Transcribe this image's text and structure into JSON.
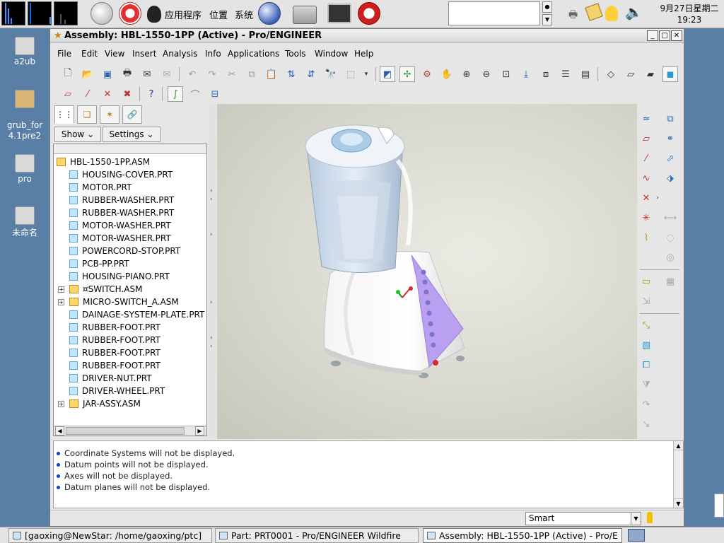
{
  "top_panel": {
    "menus": [
      "应用程序",
      "位置",
      "系统"
    ],
    "clock_date": "9月27日星期二",
    "clock_time": "19:23"
  },
  "desktop_icons": [
    "a2ub",
    "grub_for\n4.1pre2",
    "pro",
    "未命名"
  ],
  "window": {
    "title": "Assembly: HBL-1550-1PP (Active) - Pro/ENGINEER"
  },
  "menu": [
    "File",
    "Edit",
    "View",
    "Insert",
    "Analysis",
    "Info",
    "Applications",
    "Tools",
    "Window",
    "Help"
  ],
  "left_panel": {
    "show_label": "Show",
    "settings_label": "Settings",
    "tree": [
      {
        "label": "HBL-1550-1PP.ASM",
        "type": "asm",
        "level": 0,
        "expandable": false
      },
      {
        "label": "HOUSING-COVER.PRT",
        "type": "part",
        "level": 1,
        "expandable": false
      },
      {
        "label": "MOTOR.PRT",
        "type": "part",
        "level": 1,
        "expandable": false
      },
      {
        "label": "RUBBER-WASHER.PRT",
        "type": "part",
        "level": 1,
        "expandable": false
      },
      {
        "label": "RUBBER-WASHER.PRT",
        "type": "part",
        "level": 1,
        "expandable": false
      },
      {
        "label": "MOTOR-WASHER.PRT",
        "type": "part",
        "level": 1,
        "expandable": false
      },
      {
        "label": "MOTOR-WASHER.PRT",
        "type": "part",
        "level": 1,
        "expandable": false
      },
      {
        "label": "POWERCORD-STOP.PRT",
        "type": "part",
        "level": 1,
        "expandable": false
      },
      {
        "label": "PCB-PP.PRT",
        "type": "part",
        "level": 1,
        "expandable": false
      },
      {
        "label": "HOUSING-PIANO.PRT",
        "type": "part",
        "level": 1,
        "expandable": false
      },
      {
        "label": "¤SWITCH.ASM",
        "type": "asm",
        "level": 1,
        "expandable": true
      },
      {
        "label": "MICRO-SWITCH_A.ASM",
        "type": "asm",
        "level": 1,
        "expandable": true
      },
      {
        "label": "DAINAGE-SYSTEM-PLATE.PRT",
        "type": "part",
        "level": 1,
        "expandable": false
      },
      {
        "label": "RUBBER-FOOT.PRT",
        "type": "part",
        "level": 1,
        "expandable": false
      },
      {
        "label": "RUBBER-FOOT.PRT",
        "type": "part",
        "level": 1,
        "expandable": false
      },
      {
        "label": "RUBBER-FOOT.PRT",
        "type": "part",
        "level": 1,
        "expandable": false
      },
      {
        "label": "RUBBER-FOOT.PRT",
        "type": "part",
        "level": 1,
        "expandable": false
      },
      {
        "label": "DRIVER-NUT.PRT",
        "type": "part",
        "level": 1,
        "expandable": false
      },
      {
        "label": "DRIVER-WHEEL.PRT",
        "type": "part",
        "level": 1,
        "expandable": false
      },
      {
        "label": "JAR-ASSY.ASM",
        "type": "asm",
        "level": 1,
        "expandable": true
      }
    ]
  },
  "messages": [
    "Coordinate Systems will not be displayed.",
    "Datum points will not be displayed.",
    "Axes will not be displayed.",
    "Datum planes will not be displayed."
  ],
  "status": {
    "filter_value": "Smart"
  },
  "taskbar": [
    {
      "label": "[gaoxing@NewStar: /home/gaoxing/ptc]",
      "active": false
    },
    {
      "label": "Part: PRT0001 - Pro/ENGINEER Wildfire",
      "active": false
    },
    {
      "label": "Assembly: HBL-1550-1PP (Active) - Pro/E",
      "active": true
    }
  ],
  "colors": {
    "desktop": "#5a7fa6",
    "button_panel": "#b9a0f0",
    "button_dots": "#7a74c9",
    "accent_red": "#d62b2b"
  }
}
